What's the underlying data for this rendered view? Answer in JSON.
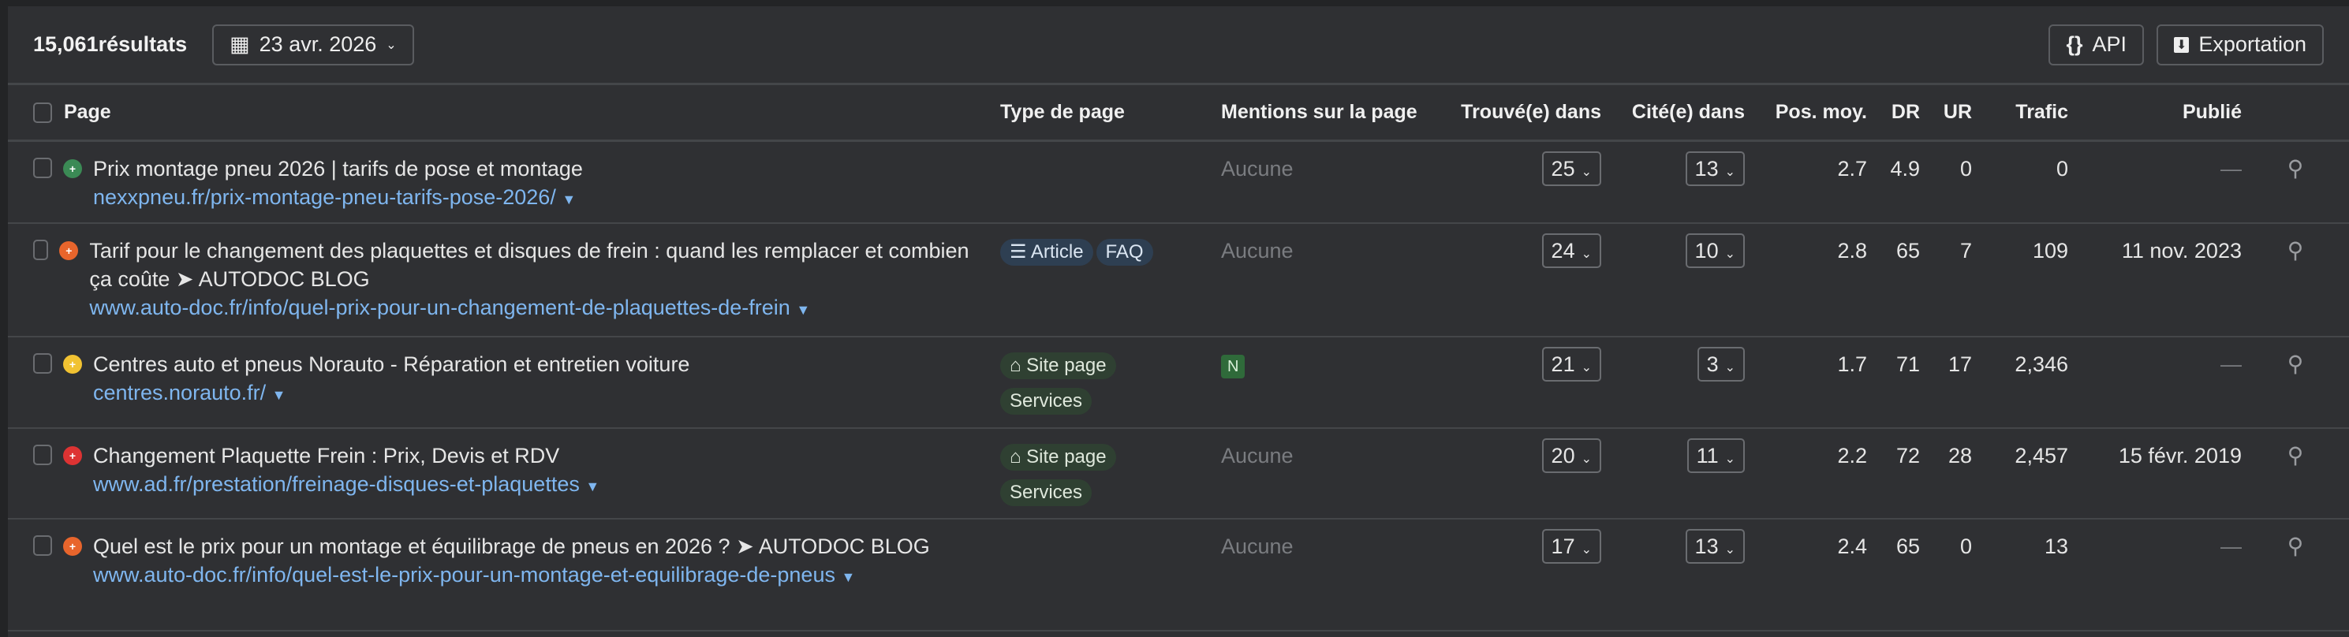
{
  "toolbar": {
    "results": "15,061résultats",
    "date": "23 avr. 2026",
    "api": "API",
    "export": "Exportation"
  },
  "columns": {
    "page": "Page",
    "type": "Type de page",
    "mentions": "Mentions sur la page",
    "found": "Trouvé(e) dans",
    "cited": "Cité(e) dans",
    "pos": "Pos. moy.",
    "dr": "DR",
    "ur": "UR",
    "traffic": "Trafic",
    "published": "Publié"
  },
  "rows": [
    {
      "title": "Prix montage pneu 2026 | tarifs de pose et montage",
      "url": "nexxpneu.fr/prix-montage-pneu-tarifs-pose-2026/",
      "fav_color": "#3b8a55",
      "types": [],
      "mention": "Aucune",
      "found": "25",
      "cited": "13",
      "pos": "2.7",
      "dr": "4.9",
      "ur": "0",
      "traffic": "0",
      "published": "—"
    },
    {
      "title": "Tarif pour le changement des plaquettes et disques de frein : quand les remplacer et combien ça coûte ➤ AUTODOC BLOG",
      "url": "www.auto-doc.fr/info/quel-prix-pour-un-changement-de-plaquettes-de-frein",
      "fav_color": "#e8652c",
      "types": [
        "Article",
        "FAQ"
      ],
      "mention": "Aucune",
      "found": "24",
      "cited": "10",
      "pos": "2.8",
      "dr": "65",
      "ur": "7",
      "traffic": "109",
      "published": "11 nov. 2023"
    },
    {
      "title": "Centres auto et pneus Norauto - Réparation et entretien voiture",
      "url": "centres.norauto.fr/",
      "fav_color": "#f1c232",
      "types": [
        "Site page",
        "Services"
      ],
      "mention": "N",
      "found": "21",
      "cited": "3",
      "pos": "1.7",
      "dr": "71",
      "ur": "17",
      "traffic": "2,346",
      "published": "—"
    },
    {
      "title": "Changement Plaquette Frein : Prix, Devis et RDV",
      "url": "www.ad.fr/prestation/freinage-disques-et-plaquettes",
      "fav_color": "#d33",
      "types": [
        "Site page",
        "Services"
      ],
      "mention": "Aucune",
      "found": "20",
      "cited": "11",
      "pos": "2.2",
      "dr": "72",
      "ur": "28",
      "traffic": "2,457",
      "published": "15 févr. 2019"
    },
    {
      "title": "Quel est le prix pour un montage et équilibrage de pneus en 2026 ? ➤ AUTODOC BLOG",
      "url": "www.auto-doc.fr/info/quel-est-le-prix-pour-un-montage-et-equilibrage-de-pneus",
      "fav_color": "#e8652c",
      "types": [],
      "mention": "Aucune",
      "found": "17",
      "cited": "13",
      "pos": "2.4",
      "dr": "65",
      "ur": "0",
      "traffic": "13",
      "published": "—"
    }
  ]
}
